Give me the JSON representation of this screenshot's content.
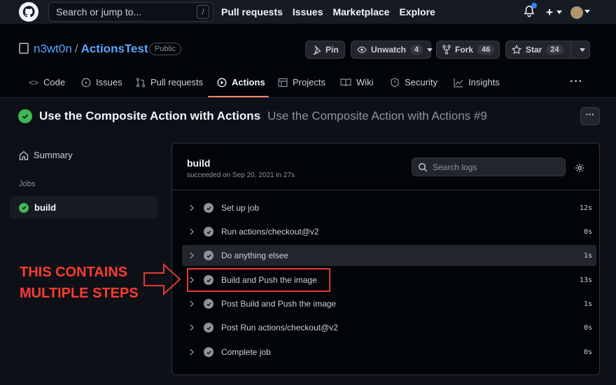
{
  "topbar": {
    "search_placeholder": "Search or jump to...",
    "slash_key": "/",
    "nav": [
      "Pull requests",
      "Issues",
      "Marketplace",
      "Explore"
    ],
    "plus": "+"
  },
  "repo": {
    "owner": "n3wt0n",
    "separator": "/",
    "name": "ActionsTest",
    "visibility": "Public",
    "pin_label": "Pin",
    "watch_label": "Unwatch",
    "watch_count": "4",
    "fork_label": "Fork",
    "fork_count": "46",
    "star_label": "Star",
    "star_count": "24"
  },
  "tabs": [
    {
      "label": "Code",
      "icon": "code-icon"
    },
    {
      "label": "Issues",
      "icon": "issue-icon"
    },
    {
      "label": "Pull requests",
      "icon": "pull-request-icon"
    },
    {
      "label": "Actions",
      "icon": "play-icon"
    },
    {
      "label": "Projects",
      "icon": "table-icon"
    },
    {
      "label": "Wiki",
      "icon": "book-icon"
    },
    {
      "label": "Security",
      "icon": "shield-icon"
    },
    {
      "label": "Insights",
      "icon": "graph-icon"
    }
  ],
  "active_tab": "Actions",
  "more_label": "···",
  "run": {
    "title": "Use the Composite Action with Actions",
    "subtitle": "Use the Composite Action with Actions #9",
    "kebab": "···"
  },
  "sidebar": {
    "summary_label": "Summary",
    "jobs_heading": "Jobs",
    "jobs": [
      {
        "label": "build"
      }
    ]
  },
  "panel": {
    "job_title": "build",
    "job_meta": "succeeded on Sep 20, 2021 in 27s",
    "search_placeholder": "Search logs",
    "steps": [
      {
        "name": "Set up job",
        "duration": "12s"
      },
      {
        "name": "Run actions/checkout@v2",
        "duration": "0s"
      },
      {
        "name": "Do anything elsee",
        "duration": "1s"
      },
      {
        "name": "Build and Push the image",
        "duration": "13s"
      },
      {
        "name": "Post Build and Push the image",
        "duration": "1s"
      },
      {
        "name": "Post Run actions/checkout@v2",
        "duration": "0s"
      },
      {
        "name": "Complete job",
        "duration": "0s"
      }
    ]
  },
  "annotation": {
    "line1": "THIS CONTAINS",
    "line2": "MULTIPLE STEPS"
  },
  "colors": {
    "accent_green": "#3fb950",
    "link_blue": "#58a6ff",
    "tab_underline": "#f78166",
    "annotation_red": "#e53935"
  }
}
